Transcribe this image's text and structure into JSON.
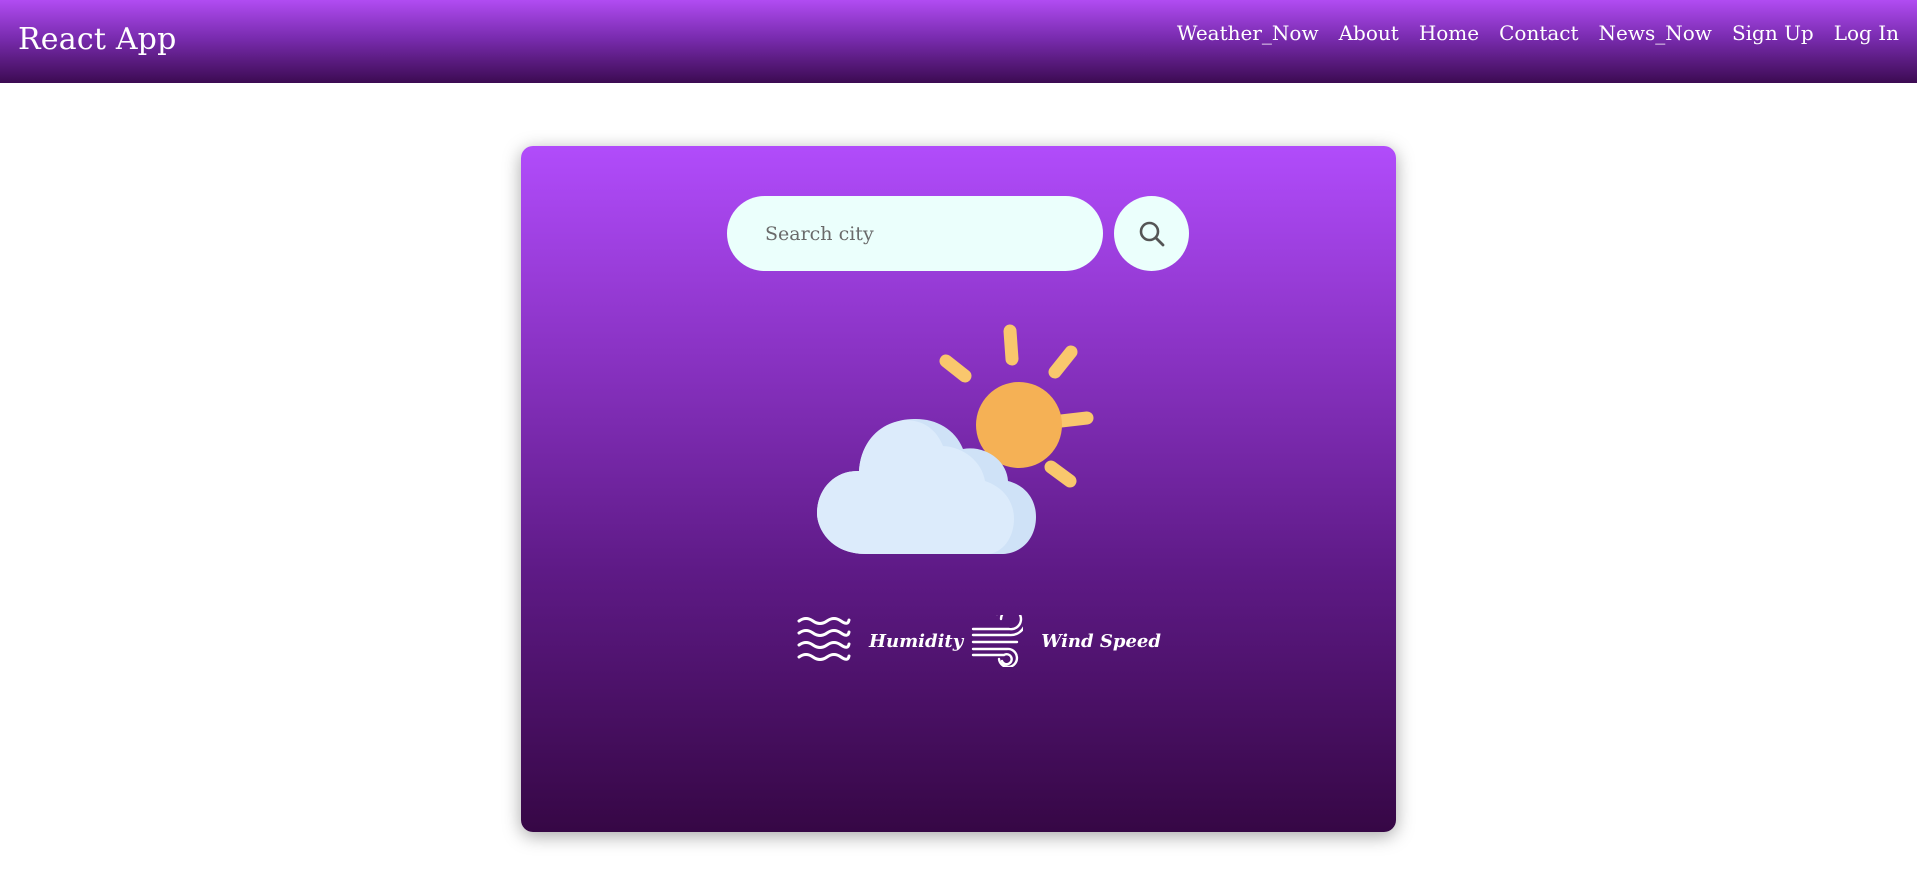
{
  "navbar": {
    "brand": "React App",
    "links": [
      "Weather_Now",
      "About",
      "Home",
      "Contact",
      "News_Now",
      "Sign Up",
      "Log In"
    ]
  },
  "search": {
    "placeholder": "Search city",
    "value": ""
  },
  "weather": {
    "icon": "cloud-sun-icon",
    "humidity_label": "Humidity",
    "humidity_icon": "waves-icon",
    "wind_label": "Wind Speed",
    "wind_icon": "wind-icon"
  },
  "colors": {
    "card_top": "#b14cfb",
    "card_bottom": "#360745",
    "search_bg": "#ebfffc",
    "sun": "#f5b155",
    "cloud": "#d6e8fb"
  }
}
